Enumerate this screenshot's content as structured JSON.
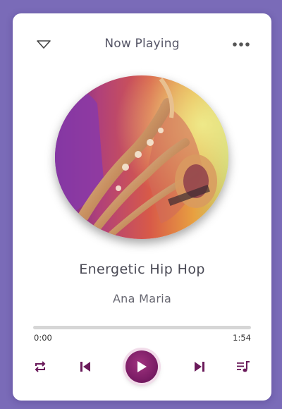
{
  "header": {
    "title": "Now Playing",
    "dropdown_icon": "chevron-down-icon",
    "more_icon": "more-horizontal-icon"
  },
  "track": {
    "title": "Energetic Hip Hop",
    "artist": "Ana Maria",
    "album_art": "saxophone-photo"
  },
  "progress": {
    "current_time": "0:00",
    "total_time": "1:54",
    "fraction": 0.0
  },
  "controls": {
    "repeat_icon": "repeat-icon",
    "prev_icon": "skip-previous-icon",
    "play_icon": "play-icon",
    "next_icon": "skip-next-icon",
    "playlist_icon": "playlist-music-icon"
  },
  "colors": {
    "background": "#7a6bb8",
    "accent": "#7c1d66",
    "progress_track": "#d6d6d6"
  }
}
